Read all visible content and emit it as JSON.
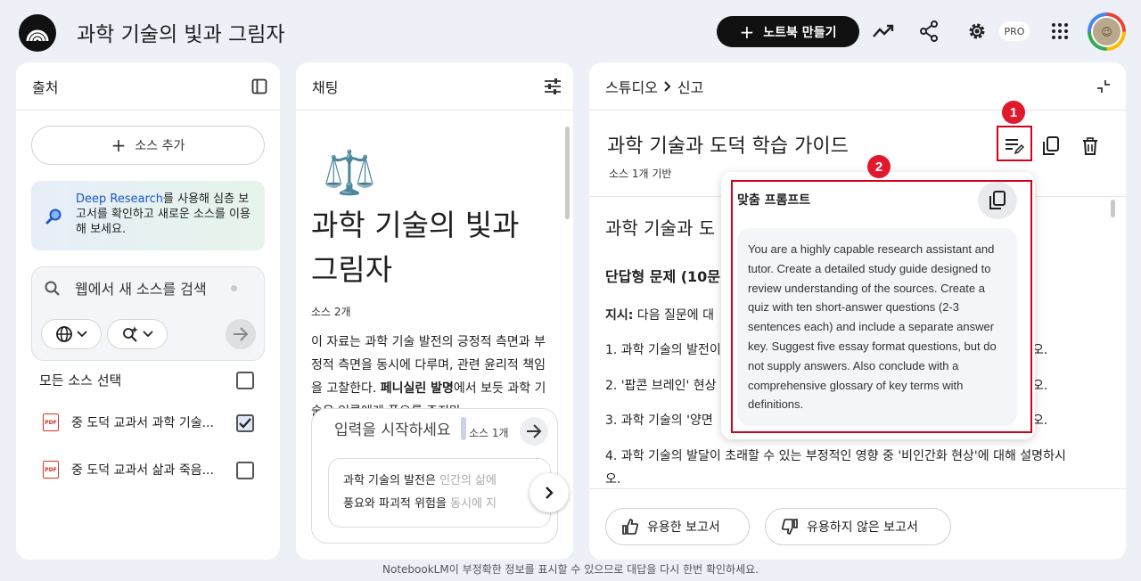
{
  "app": {
    "title": "과학 기술의 빛과 그림자",
    "create_notebook_label": "노트북 만들기",
    "pro_badge": "PRO",
    "footer_notice": "NotebookLM이 부정확한 정보를 표시할 수 있으므로 대답을 다시 한번 확인하세요."
  },
  "sources": {
    "header": "출처",
    "add_label": "소스 추가",
    "deep_research": {
      "link": "Deep Research",
      "text": "를 사용해 심층 보고서를 확인하고 새로운 소스를 이용해 보세요."
    },
    "search_placeholder": "웹에서 새 소스를 검색",
    "select_all_label": "모든 소스 선택",
    "items": [
      {
        "label": "중 도덕 교과서 과학 기술...",
        "checked": true
      },
      {
        "label": "중 도덕 교과서 삶과 죽음...",
        "checked": false
      }
    ]
  },
  "chat": {
    "header": "채팅",
    "emoji": "⚖️",
    "title": "과학 기술의 빛과 그림자",
    "source_count": "소스 2개",
    "summary_pre": "이 자료는 과학 기술 발전의 긍정적 측면과 부정적 측면을 동시에 다루며, 관련 윤리적 책임을 고찰한다. ",
    "summary_bold": "페니실린 발명",
    "summary_post": "에서 보듯 과학 기술은 인류에게 풍요를 주지만",
    "input_placeholder": "입력을 시작하세요",
    "input_source_count": "소스 1개",
    "suggestion_main": "과학 기술의 발전은 ",
    "suggestion_fade": "인간의 삶에",
    "suggestion_line2_main": "풍요와 파괴적 위험을 ",
    "suggestion_line2_fade": "동시에 지"
  },
  "studio": {
    "breadcrumb_root": "스튜디오",
    "breadcrumb_current": "신고",
    "note_title": "과학 기술과 도덕 학습 가이드",
    "note_subtitle": "소스 1개 기반",
    "doc_heading": "과학 기술과 도",
    "section_title": "단답형 문제 (10문",
    "instruction_label": "지시:",
    "instruction_text": " 다음 질문에 대",
    "q1_start": "1. 과학 기술의 발전이",
    "q1_end": "오.",
    "q2_start": "2. '팝콘 브레인' 현상",
    "q2_end": "오.",
    "q3_start": "3. 과학 기술의 '양면",
    "q3_end": "오.",
    "q4": "4. 과학 기술의 발달이 초래할 수 있는 부정적인 영향 중 '비인간화 현상'에 대해 설명하시",
    "q4_cont": "오.",
    "helpful_label": "유용한 보고서",
    "not_helpful_label": "유용하지 않은 보고서"
  },
  "popup": {
    "title": "맞춤 프롬프트",
    "prompt": "You are a highly capable research assistant and tutor. Create a detailed study guide designed to review understanding of the sources. Create a quiz with ten short-answer questions (2-3 sentences each) and include a separate answer key. Suggest five essay format questions, but do not supply answers. Also conclude with a comprehensive glossary of key terms with definitions."
  },
  "annotations": {
    "marker_1": "1",
    "marker_2": "2",
    "highlight_color": "#d0021b"
  }
}
